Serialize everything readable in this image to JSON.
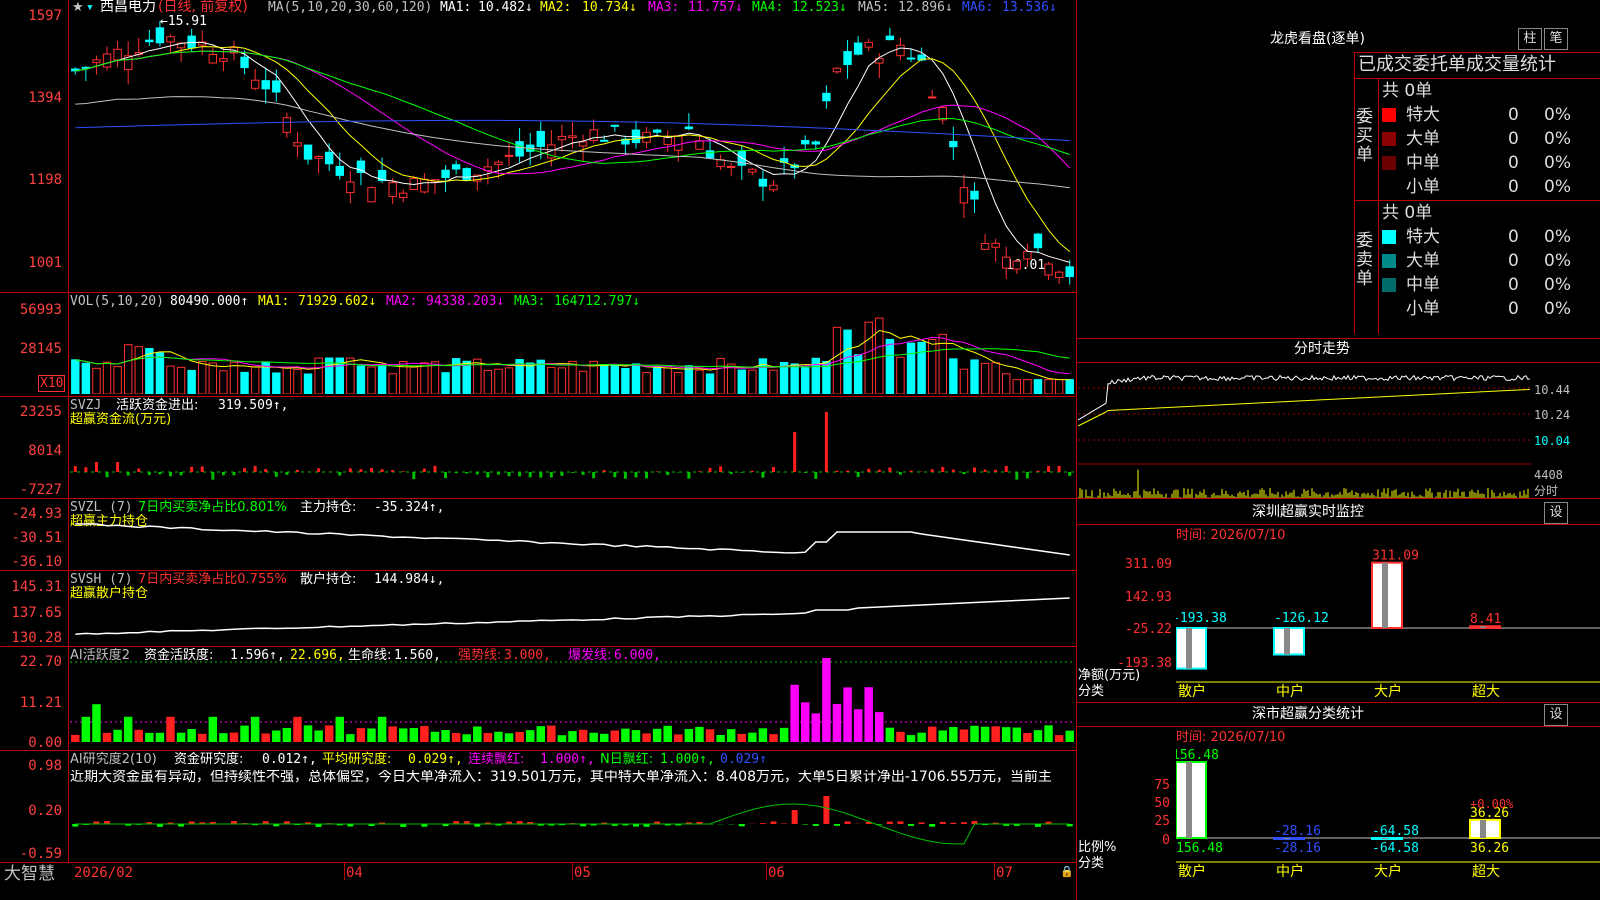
{
  "stock": {
    "name": "西昌电力",
    "period": "(日线, 前复权)"
  },
  "main_chart": {
    "ma_label": "MA(5,10,20,30,60,120)",
    "ma": [
      {
        "label": "MA1:",
        "value": "10.482↓",
        "color": "#ffffff"
      },
      {
        "label": "MA2:",
        "value": "10.734↓",
        "color": "#ffff00"
      },
      {
        "label": "MA3:",
        "value": "11.757↓",
        "color": "#ff00ff"
      },
      {
        "label": "MA4:",
        "value": "12.523↓",
        "color": "#00ff00"
      },
      {
        "label": "MA5:",
        "value": "12.896↓",
        "color": "#c0c0c0"
      },
      {
        "label": "MA6:",
        "value": "13.536↓",
        "color": "#3050ff"
      }
    ],
    "y_labels": [
      "1597",
      "1394",
      "1198",
      "1001"
    ],
    "high_note": "←15.91",
    "low_note": "10.01→",
    "ma_colors": [
      "#ffffff",
      "#ffff00",
      "#ff00ff",
      "#00ff00",
      "#c0c0c0",
      "#3050ff"
    ]
  },
  "vol_panel": {
    "title": "VOL(5,10,20)",
    "value": "80490.000↑",
    "ma": [
      {
        "label": "MA1:",
        "value": "71929.602↓",
        "color": "#ffff00"
      },
      {
        "label": "MA2:",
        "value": "94338.203↓",
        "color": "#ff00ff"
      },
      {
        "label": "MA3:",
        "value": "164712.797↓",
        "color": "#00ff00"
      }
    ],
    "y_labels": [
      "56993",
      "28145"
    ],
    "unit": "X10"
  },
  "svzj_panel": {
    "title": "SVZJ",
    "label": "活跃资金进出:",
    "value": "319.509↑,",
    "subtitle": "超赢资金流(万元)",
    "y_labels": [
      "23255",
      "8014",
      "-7227"
    ]
  },
  "svzl_panel": {
    "title": "SVZL (7)",
    "ratio": "7日内买卖净占比0.801%",
    "label": "主力持仓:",
    "value": "-35.324↑,",
    "subtitle": "超赢主力持仓",
    "y_labels": [
      "-24.93",
      "-30.51",
      "-36.10"
    ]
  },
  "svsh_panel": {
    "title": "SVSH (7)",
    "ratio": "7日内买卖净占比0.755%",
    "label": "散户持仓:",
    "value": "144.984↓,",
    "subtitle": "超赢散户持仓",
    "y_labels": [
      "145.31",
      "137.65",
      "130.28"
    ]
  },
  "ai_active_panel": {
    "title": "AI活跃度2",
    "label": "资金活跃度:",
    "value": "1.596↑,",
    "v2": "22.696,",
    "life_label": "生命线:",
    "life_value": "1.560,",
    "strong_label": "强势线:",
    "strong_value": "3.000,",
    "burst_label": "爆发线:",
    "burst_value": "6.000,",
    "y_labels": [
      "22.70",
      "11.21",
      "0.00"
    ]
  },
  "ai_research_panel": {
    "title": "AI研究度2(10)",
    "r1_label": "资金研究度:",
    "r1_value": "0.012↑,",
    "r2_label": "平均研究度:",
    "r2_value": "0.029↑,",
    "r3_label": "连续飘红:",
    "r3_value": "1.000↑,",
    "r4_label": "N日飘红:",
    "r4_value": "1.000↑,",
    "r5_value": "0.029↑",
    "comment": "近期大资金虽有异动，但持续性不强，总体偏空，今日大单净流入：319.501万元，其中特大单净流入：8.408万元，大单5日累计净出-1706.55万元，当前主",
    "y_labels": [
      "0.98",
      "0.20",
      "-0.59"
    ]
  },
  "x_axis": {
    "labels": [
      "2026/02",
      "04",
      "05",
      "06",
      "07"
    ],
    "brand": "大智慧"
  },
  "lhb": {
    "title": "龙虎看盘(逐单)",
    "btn_zhu": "柱",
    "btn_bi": "笔",
    "header": "已成交委托单成交量统计",
    "buy": {
      "side": "委买单",
      "total": "共 0单",
      "rows": [
        {
          "name": "特大",
          "vol": "0",
          "pct": "0%",
          "color": "#ff0000"
        },
        {
          "name": "大单",
          "vol": "0",
          "pct": "0%",
          "color": "#8b0000"
        },
        {
          "name": "中单",
          "vol": "0",
          "pct": "0%",
          "color": "#6b0000"
        },
        {
          "name": "小单",
          "vol": "0",
          "pct": "0%",
          "color": "#000000"
        }
      ]
    },
    "sell": {
      "side": "委卖单",
      "total": "共 0单",
      "rows": [
        {
          "name": "特大",
          "vol": "0",
          "pct": "0%",
          "color": "#00ffff"
        },
        {
          "name": "大单",
          "vol": "0",
          "pct": "0%",
          "color": "#008b8b"
        },
        {
          "name": "中单",
          "vol": "0",
          "pct": "0%",
          "color": "#006b6b"
        },
        {
          "name": "小单",
          "vol": "0",
          "pct": "0%",
          "color": "#000000"
        }
      ]
    }
  },
  "intraday": {
    "title": "分时走势",
    "right_labels": [
      "10.44",
      "10.24",
      "10.04",
      "4408",
      "分时"
    ]
  },
  "monitor": {
    "title": "深圳超赢实时监控",
    "btn": "设",
    "time": "时间: 2026/07/10",
    "y_labels": [
      "311.09",
      "142.93",
      "-25.22",
      "-193.38"
    ],
    "axis_caption": "净额(万元)",
    "cat_caption": "分类",
    "bars": [
      {
        "label": "散户",
        "value": -193.38,
        "text": "-193.38",
        "color": "#00ffff"
      },
      {
        "label": "中户",
        "value": -126.12,
        "text": "-126.12",
        "color": "#00ffff"
      },
      {
        "label": "大户",
        "value": 311.09,
        "text": "311.09",
        "color": "#ff3030"
      },
      {
        "label": "超大",
        "value": 8.41,
        "text": "8.41",
        "color": "#ff3030"
      }
    ]
  },
  "classify": {
    "title": "深市超赢分类统计",
    "btn": "设",
    "time": "时间: 2026/07/10",
    "y_labels": [
      "75",
      "50",
      "25",
      "0"
    ],
    "axis_caption": "比例%",
    "cat_caption": "分类",
    "bars": [
      {
        "label": "散户",
        "value": 156.48,
        "text": "156.48",
        "color": "#00ff00"
      },
      {
        "label": "中户",
        "value": -28.16,
        "text": "-28.16",
        "color": "#3050ff"
      },
      {
        "label": "大户",
        "value": -64.58,
        "text": "-64.58",
        "color": "#00ffff"
      },
      {
        "label": "超大",
        "value": 36.26,
        "text": "36.26",
        "color": "#ffff00"
      }
    ],
    "note": "+0.00%"
  }
}
